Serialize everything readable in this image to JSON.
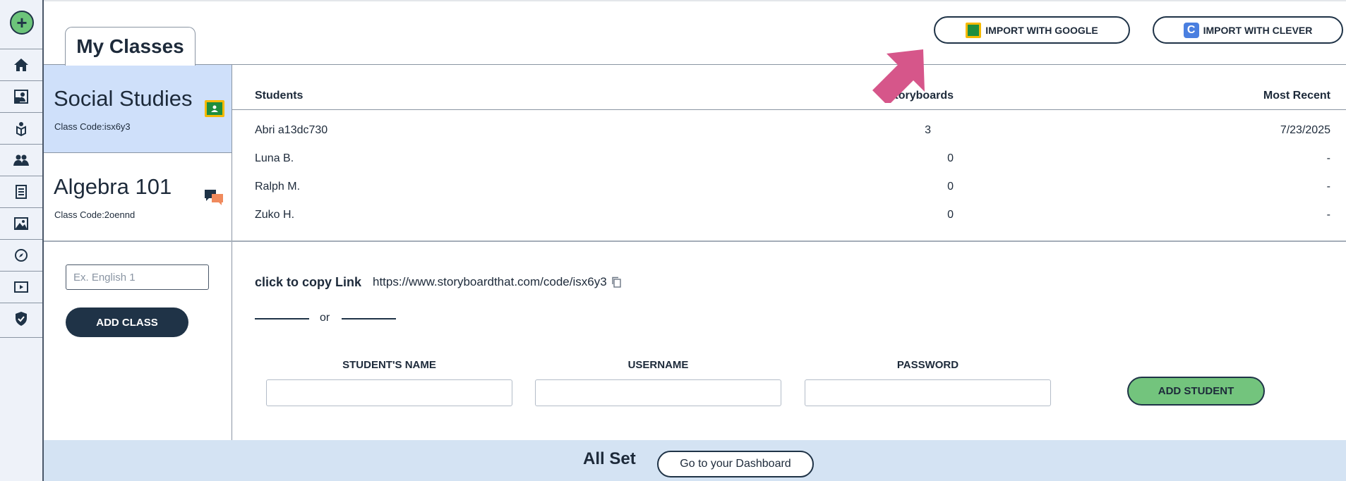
{
  "page": {
    "title": "My Classes"
  },
  "import": {
    "google_label": "IMPORT WITH GOOGLE",
    "clever_label": "IMPORT WITH CLEVER",
    "clever_letter": "C"
  },
  "rail": {
    "add_symbol": "+"
  },
  "classes": [
    {
      "name": "Social Studies",
      "code": "Class Code:isx6y3",
      "source": "google-classroom"
    },
    {
      "name": "Algebra 101",
      "code": "Class Code:2oennd",
      "source": "chat"
    }
  ],
  "new_class": {
    "placeholder": "Ex. English 1",
    "button_label": "ADD CLASS"
  },
  "students_table": {
    "headers": {
      "students": "Students",
      "storyboards": "Storyboards",
      "most_recent": "Most Recent"
    },
    "rows": [
      {
        "name": "Abri a13dc730",
        "storyboards": "3",
        "most_recent": "7/23/2025"
      },
      {
        "name": "Luna B.",
        "storyboards": "0",
        "most_recent": "-"
      },
      {
        "name": "Ralph M.",
        "storyboards": "0",
        "most_recent": "-"
      },
      {
        "name": "Zuko H.",
        "storyboards": "0",
        "most_recent": "-"
      }
    ]
  },
  "link": {
    "label": "click to copy Link",
    "url": "https://www.storyboardthat.com/code/isx6y3",
    "or_text": "or"
  },
  "add_student_form": {
    "name_label": "STUDENT'S NAME",
    "username_label": "USERNAME",
    "password_label": "PASSWORD",
    "button_label": "ADD STUDENT"
  },
  "footer": {
    "status": "All Set",
    "dashboard_label": "Go to your Dashboard"
  },
  "colors": {
    "accent_green": "#73c47d",
    "navy": "#1f3347",
    "active_class_bg": "#cfe0fa",
    "arrow": "#d6568a"
  }
}
